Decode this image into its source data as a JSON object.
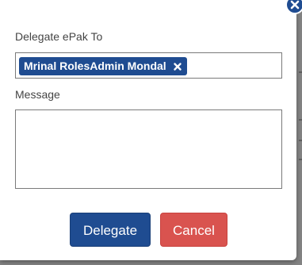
{
  "dialog": {
    "delegate_label": "Delegate ePak To",
    "selected_recipient": "Mrinal RolesAdmin Mondal",
    "message_label": "Message",
    "message_value": "",
    "delegate_button": "Delegate",
    "cancel_button": "Cancel"
  },
  "icons": {
    "close": "close-icon",
    "remove_chip": "remove-icon"
  },
  "colors": {
    "primary": "#1f4c91",
    "danger": "#d9534f",
    "backdrop": "#838383"
  }
}
